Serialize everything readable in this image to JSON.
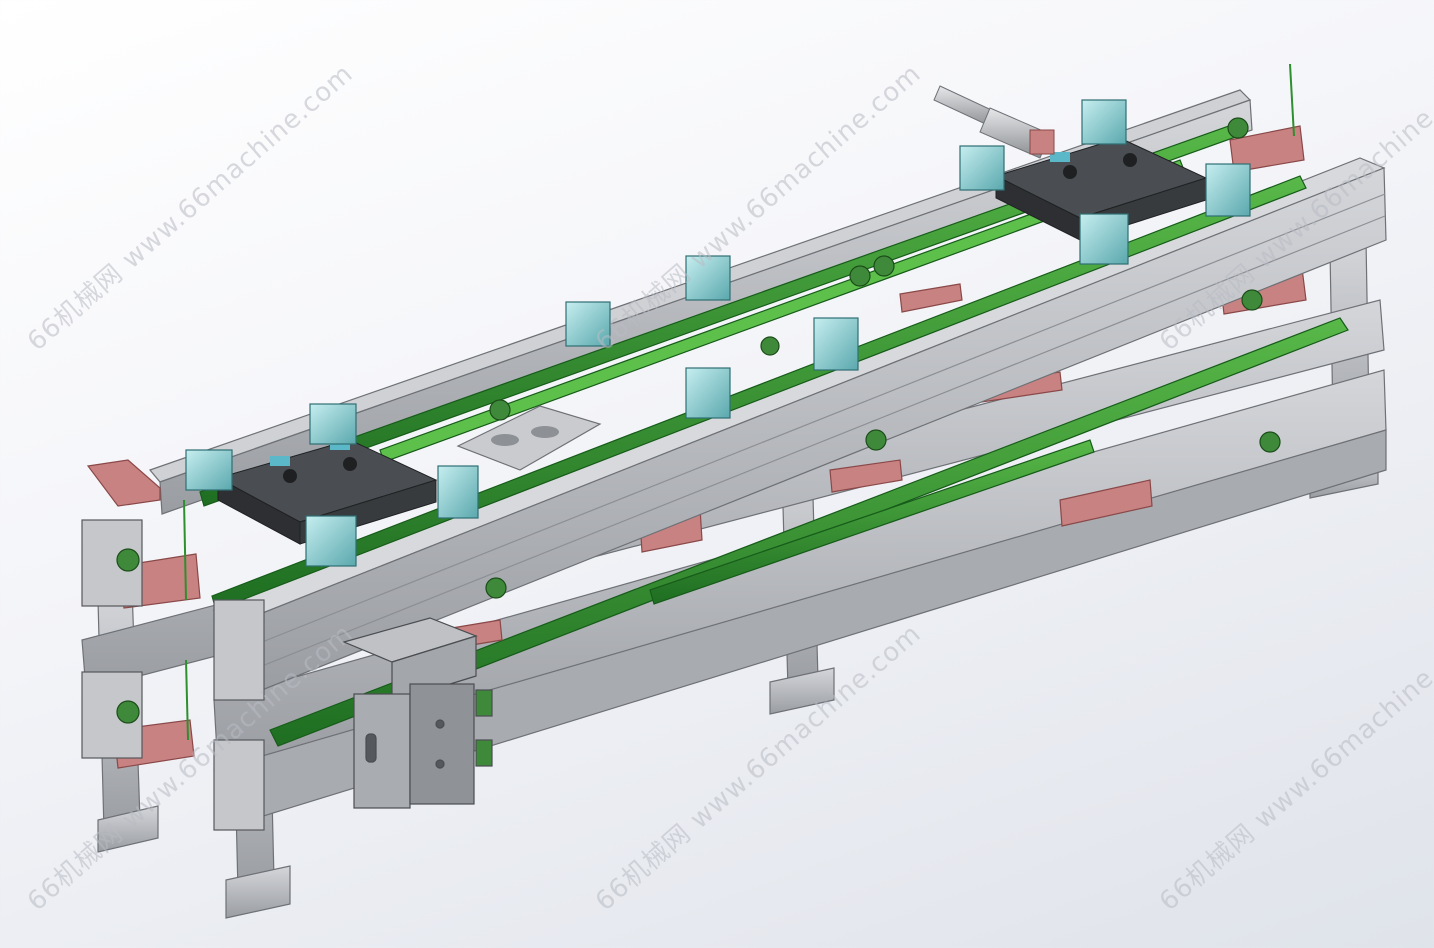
{
  "watermark": {
    "text": "66机械网 www.66machine.com"
  },
  "colors": {
    "frame": "#b4b6ba",
    "frame_dark": "#7f8287",
    "belt": "#2e8f2e",
    "belt_light": "#6fcf5d",
    "block": "#9fd2d6",
    "block_dark": "#5aa8ad",
    "bracket": "#c98282",
    "bracket_dark": "#a05a5a",
    "pallet": "#3f4245",
    "cylinder": "#9d9fa3",
    "background_top": "#ffffff",
    "background_bottom": "#dfe3ea"
  }
}
